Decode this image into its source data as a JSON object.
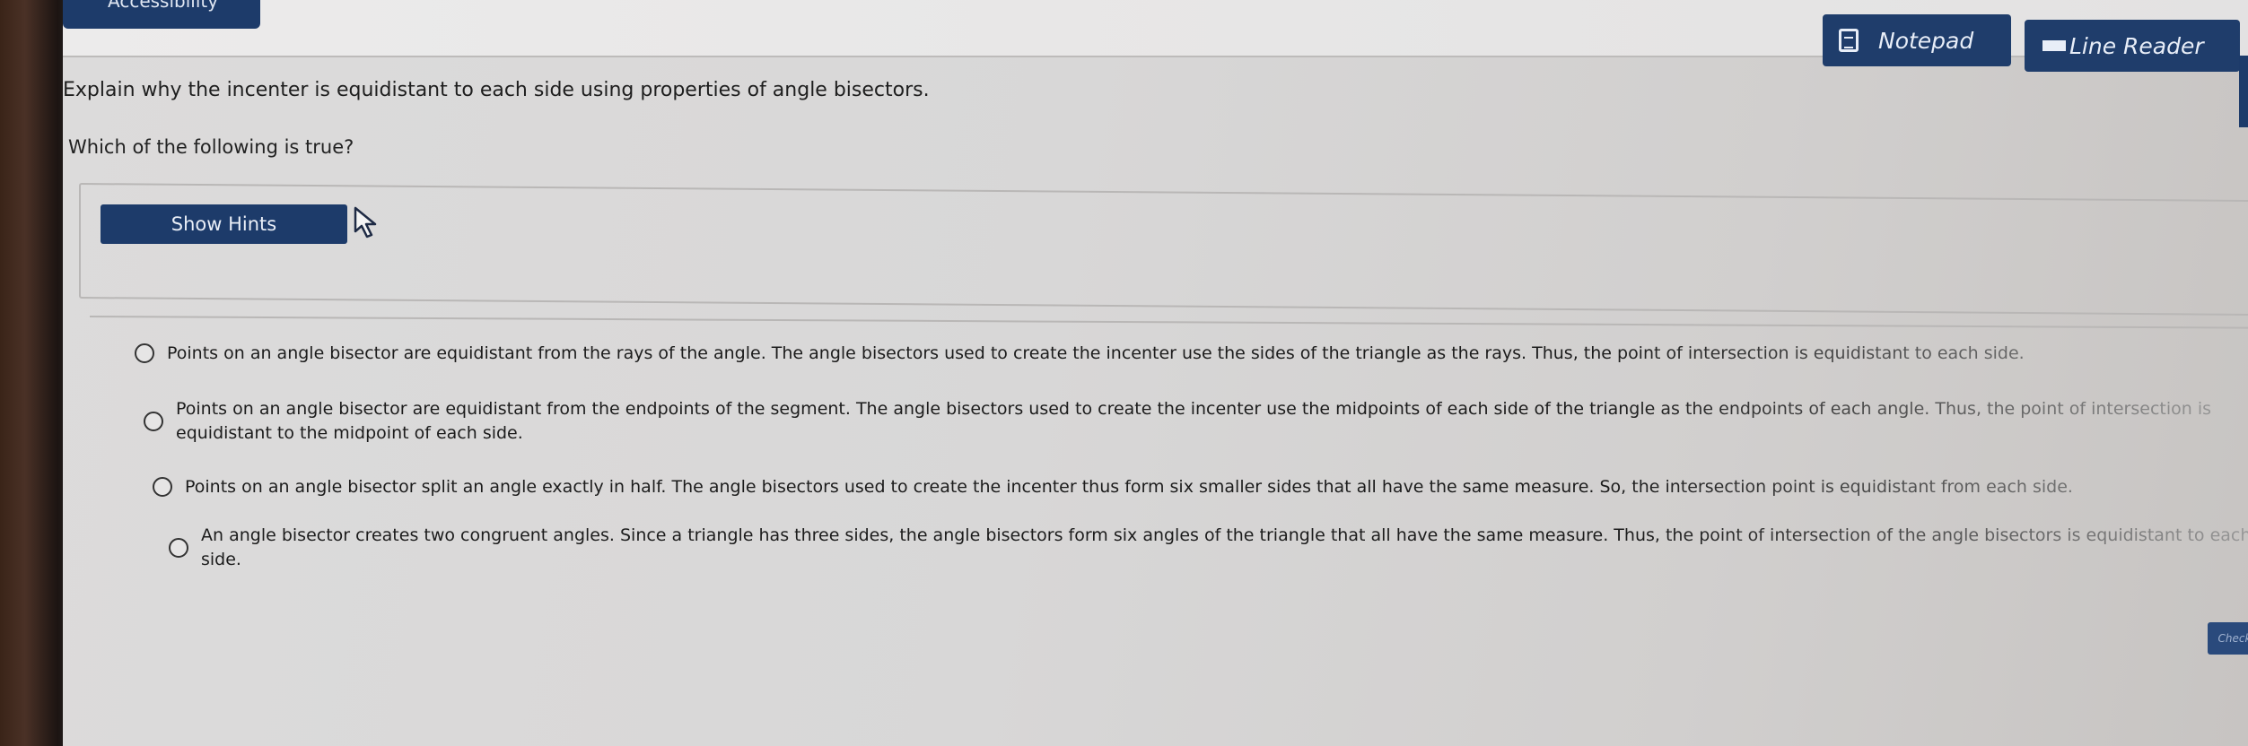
{
  "toolbar": {
    "accessibility_label": "Accessibility",
    "notepad_label": "Notepad",
    "line_reader_label": "Line Reader"
  },
  "question": {
    "prompt": "Explain why the incenter is equidistant to each side using properties of angle bisectors.",
    "subprompt": "Which of the following is true?"
  },
  "hints": {
    "button_label": "Show Hints"
  },
  "options": [
    {
      "text": "Points on an angle bisector are equidistant from the rays of the angle. The angle bisectors used to create the incenter use the sides of the triangle as the rays. Thus, the point of intersection is equidistant to each side."
    },
    {
      "text": "Points on an angle bisector are equidistant from the endpoints of the segment. The angle bisectors used to create the incenter use the midpoints of each side of the triangle as the endpoints of each angle. Thus, the point of intersection is equidistant to the midpoint of each side."
    },
    {
      "text": "Points on an angle bisector split an angle exactly in half. The angle bisectors used to create the incenter thus form six smaller sides that all have the same measure. So, the intersection point is equidistant from each side."
    },
    {
      "text": "An angle bisector creates two congruent angles. Since a triangle has three sides, the angle bisectors form six angles of the triangle that all have the same measure. Thus, the point of intersection of the angle bisectors is equidistant to each side."
    }
  ],
  "actions": {
    "check_label": "Check"
  },
  "colors": {
    "primary_button": "#1d3b6a",
    "background": "#d8d7d7"
  },
  "icons": {
    "notepad": "notepad-icon",
    "line_reader": "line-reader-icon",
    "cursor": "mouse-cursor-icon"
  }
}
